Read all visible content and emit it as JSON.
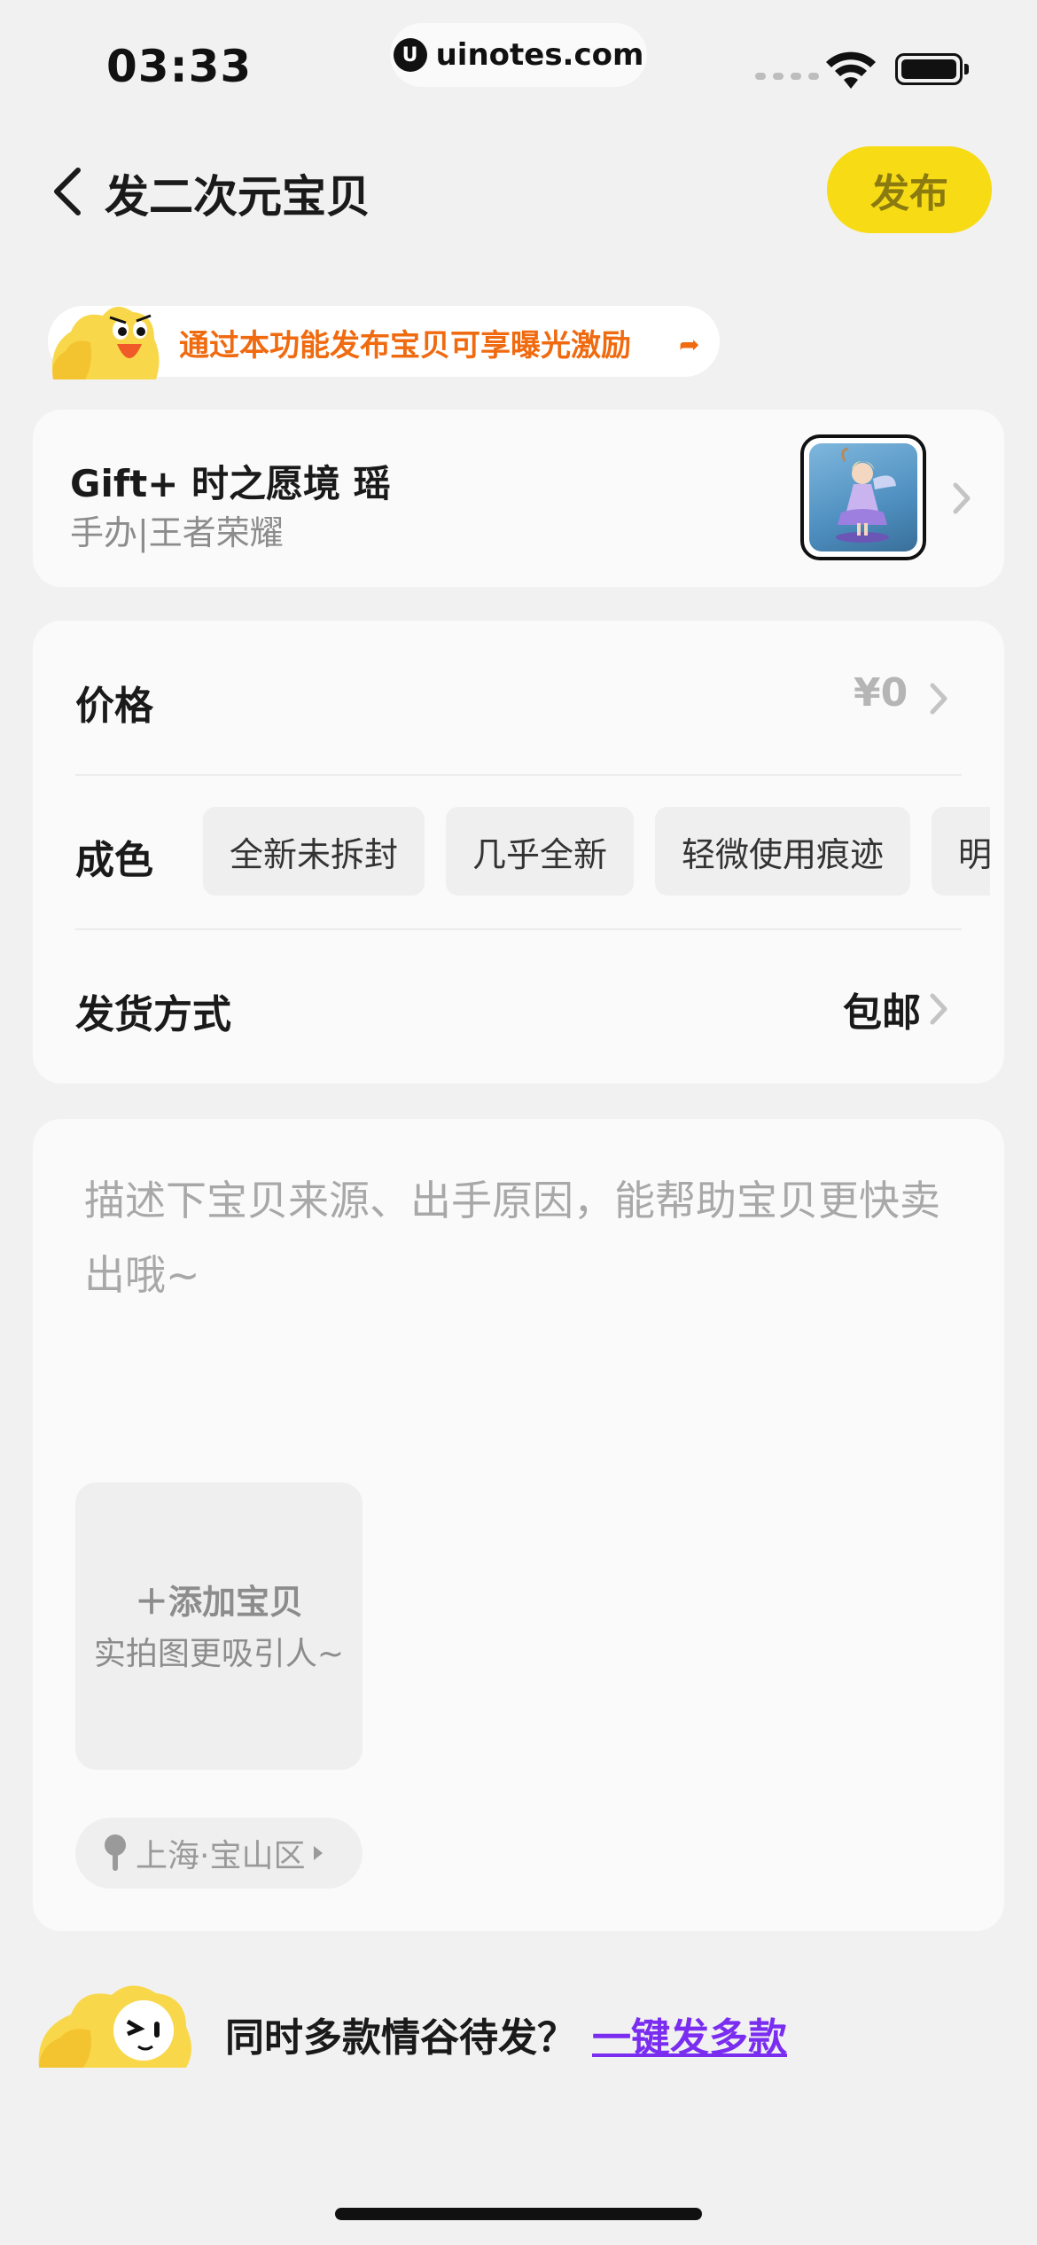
{
  "status_bar": {
    "time": "03:33",
    "url": "uinotes.com",
    "url_logo": "U"
  },
  "nav": {
    "title": "发二次元宝贝",
    "publish_label": "发布",
    "back_icon": "chevron-left-icon"
  },
  "promo": {
    "text": "通过本功能发布宝贝可享曝光激励",
    "arrow": "➦"
  },
  "product": {
    "name": "Gift+ 时之愿境 瑶",
    "category": "手办|王者荣耀"
  },
  "price": {
    "label": "价格",
    "value": "¥0"
  },
  "condition": {
    "label": "成色",
    "options": [
      "全新未拆封",
      "几乎全新",
      "轻微使用痕迹",
      "明显使用痕迹"
    ]
  },
  "shipping": {
    "label": "发货方式",
    "value": "包邮"
  },
  "description": {
    "placeholder": "描述下宝贝来源、出手原因，能帮助宝贝更快卖出哦~",
    "add_photo_title": "添加宝贝",
    "add_photo_hint": "实拍图更吸引人~",
    "location": "上海·宝山区"
  },
  "footer": {
    "question": "同时多款情谷待发？",
    "link": "一键发多款"
  },
  "colors": {
    "accent_yellow": "#f6db15",
    "promo_orange": "#f06a0f",
    "link_purple": "#7a2df0"
  }
}
